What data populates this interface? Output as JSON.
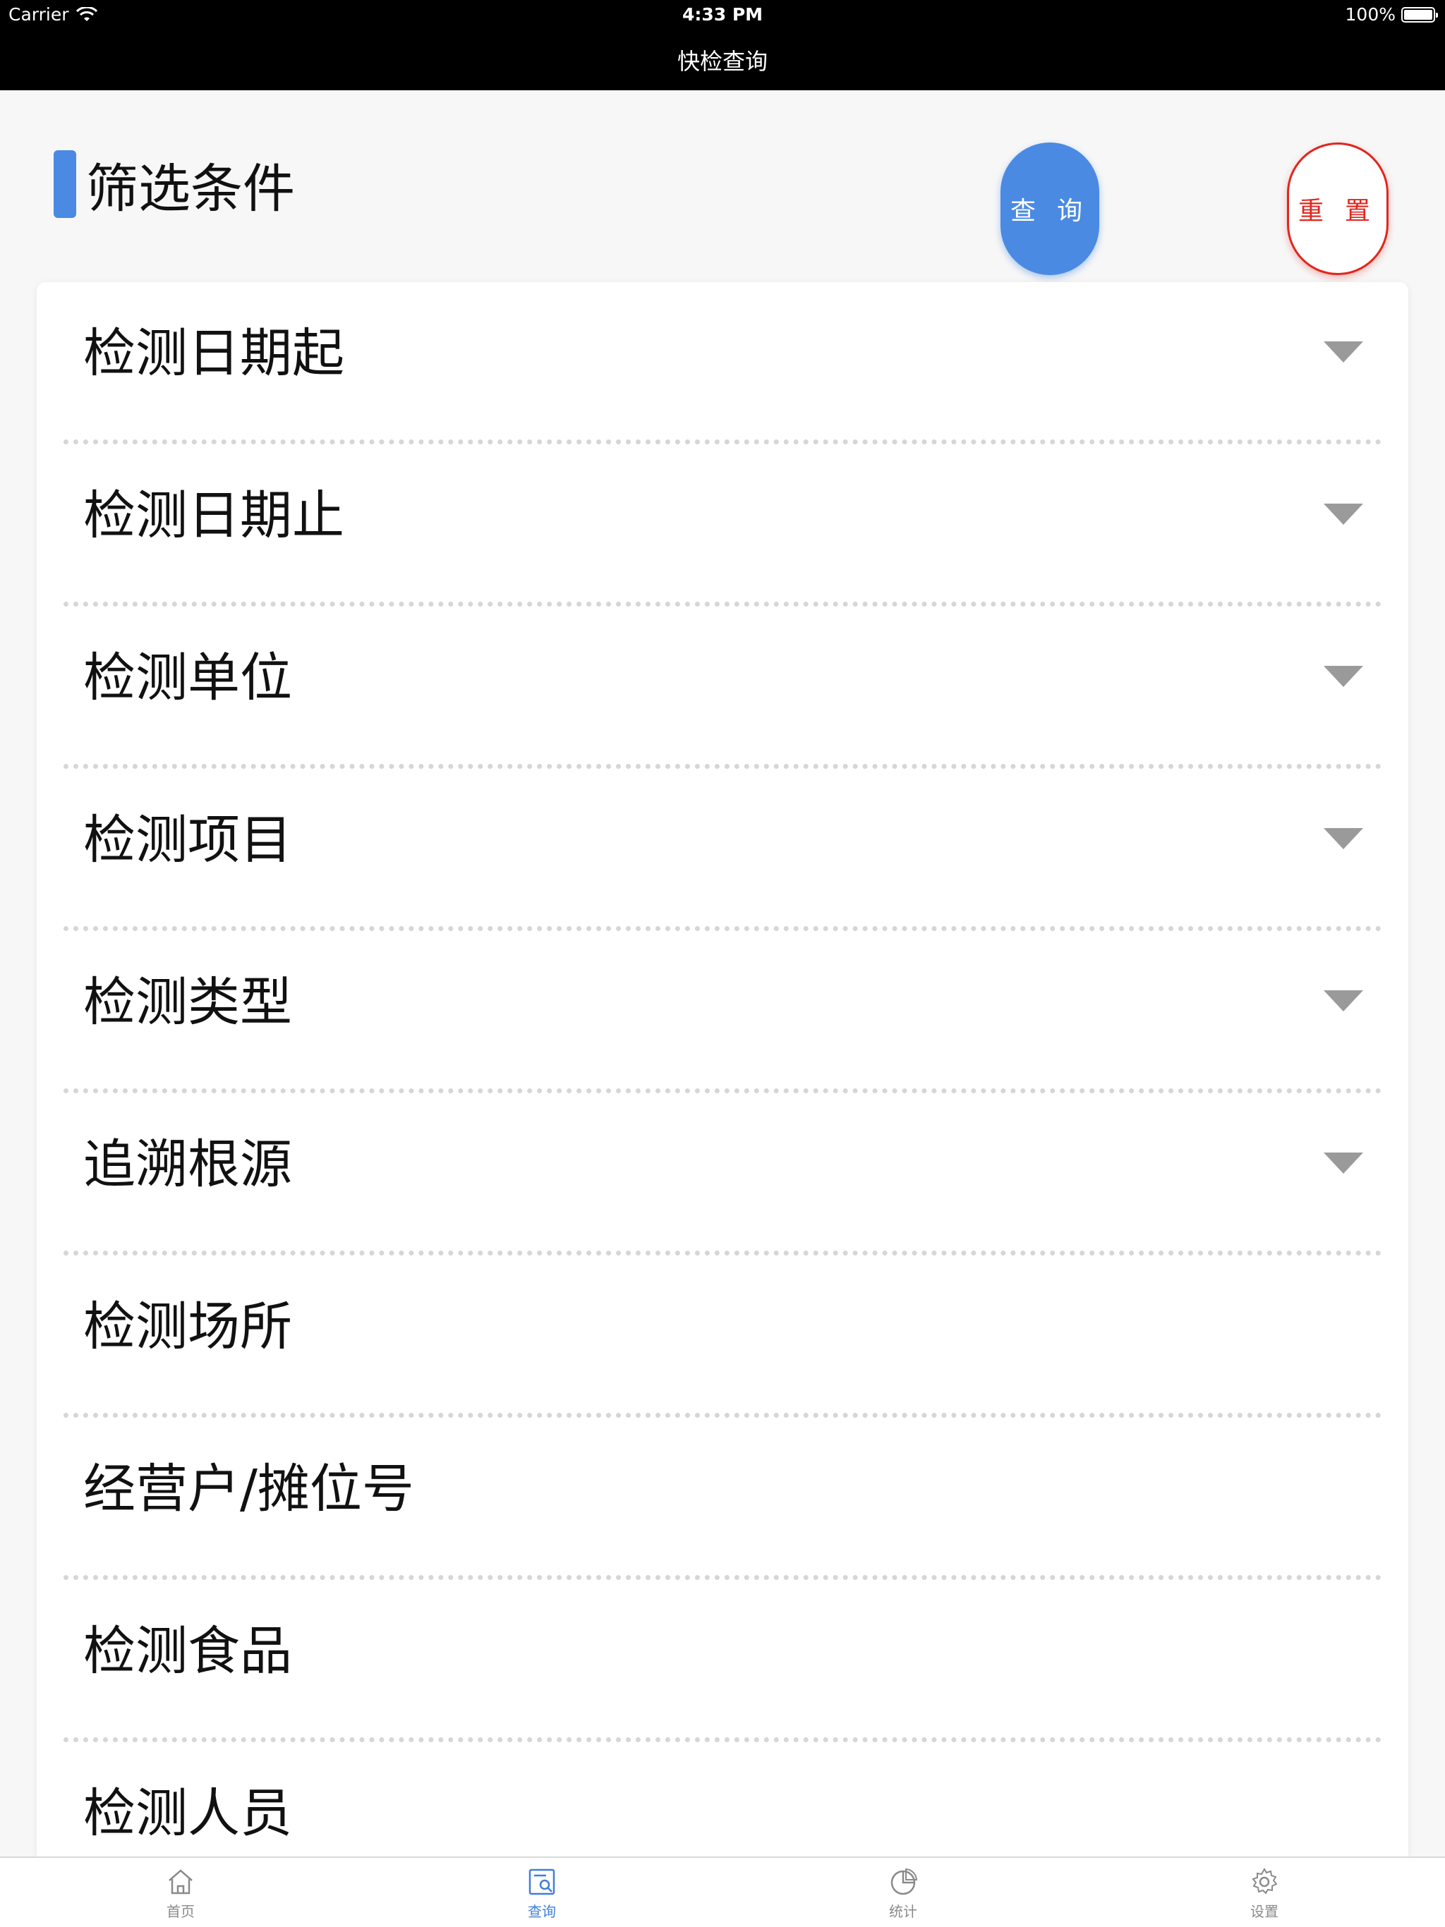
{
  "status_bar": {
    "carrier": "Carrier",
    "time": "4:33 PM",
    "battery": "100%"
  },
  "nav": {
    "title": "快检查询"
  },
  "filter": {
    "title": "筛选条件",
    "query_label": "查 询",
    "reset_label": "重 置"
  },
  "fields": [
    {
      "label": "检测日期起",
      "has_dropdown": true
    },
    {
      "label": "检测日期止",
      "has_dropdown": true
    },
    {
      "label": "检测单位",
      "has_dropdown": true
    },
    {
      "label": "检测项目",
      "has_dropdown": true
    },
    {
      "label": "检测类型",
      "has_dropdown": true
    },
    {
      "label": "追溯根源",
      "has_dropdown": true
    },
    {
      "label": "检测场所",
      "has_dropdown": false
    },
    {
      "label": "经营户/摊位号",
      "has_dropdown": false
    },
    {
      "label": "检测食品",
      "has_dropdown": false
    },
    {
      "label": "检测人员",
      "has_dropdown": false
    }
  ],
  "tabs": [
    {
      "label": "首页",
      "icon": "home-icon",
      "active": false
    },
    {
      "label": "查询",
      "icon": "search-doc-icon",
      "active": true
    },
    {
      "label": "统计",
      "icon": "pie-chart-icon",
      "active": false
    },
    {
      "label": "设置",
      "icon": "gear-icon",
      "active": false
    }
  ],
  "colors": {
    "accent": "#4a8ae2",
    "reset": "#e0261d",
    "tab_active": "#3f7fd9",
    "tab_inactive": "#8a8a8a"
  }
}
